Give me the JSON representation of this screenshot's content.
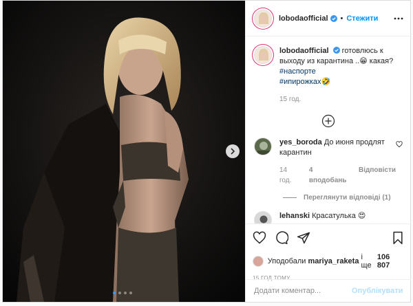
{
  "post": {
    "username": "lobodaofficial",
    "follow_label": "Стежити",
    "separator": "•",
    "carousel_slides": 4,
    "carousel_active": 0
  },
  "caption": {
    "username": "lobodaofficial",
    "text": "готовлюсь к выходу из карантина ..😁 какая?",
    "hashtags": [
      "#наспорте",
      "#ипирожках🤣"
    ],
    "time": "15 год."
  },
  "comments": [
    {
      "username": "yes_boroda",
      "text": "До июня продлят карантин",
      "time": "14 год.",
      "likes": "4 вподобань",
      "reply_label": "Відповісти",
      "view_replies": "Переглянути відповіді (1)"
    },
    {
      "username": "lehanski",
      "text": "Красатулька 😍"
    }
  ],
  "likes": {
    "prefix": "Уподобали",
    "user": "mariya_raketa",
    "middle": "і ще",
    "count": "106 807"
  },
  "timestamp": "15 ГОД ТОМУ",
  "comment_box": {
    "placeholder": "Додати коментар...",
    "publish_label": "Опублікувати"
  },
  "colors": {
    "accent": "#0095f6",
    "verified": "#3897f0",
    "hashtag": "#00376b",
    "muted": "#8e8e8e"
  }
}
